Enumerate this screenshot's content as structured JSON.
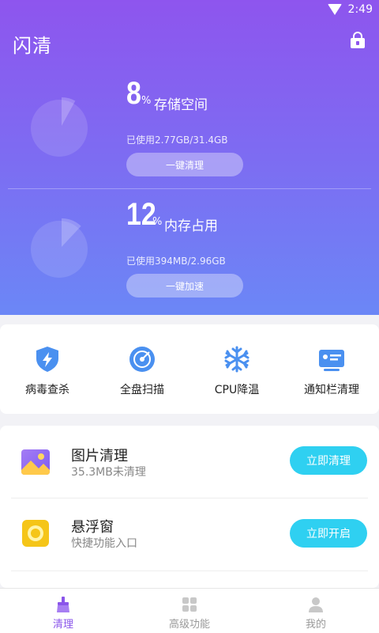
{
  "status_bar": {
    "time": "2:49",
    "wifi_icon": "wifi-icon"
  },
  "header": {
    "title": "闪清",
    "lock_icon": "lock-icon"
  },
  "storage": {
    "percent": "8",
    "percent_sign": "%",
    "label": "存储空间",
    "usage_text": "已使用2.77GB/31.4GB",
    "button_label": "一键清理",
    "used_fraction": 0.08
  },
  "memory": {
    "percent": "12",
    "percent_sign": "%",
    "label": "内存占用",
    "usage_text": "已使用394MB/2.96GB",
    "button_label": "一键加速",
    "used_fraction": 0.12
  },
  "tools": [
    {
      "label": "病毒查杀",
      "icon": "shield-lightning-icon"
    },
    {
      "label": "全盘扫描",
      "icon": "scan-radar-icon"
    },
    {
      "label": "CPU降温",
      "icon": "snowflake-icon"
    },
    {
      "label": "通知栏清理",
      "icon": "notification-card-icon"
    }
  ],
  "features": [
    {
      "title": "图片清理",
      "subtitle": "35.3MB未清理",
      "button": "立即清理",
      "icon": "picture-icon"
    },
    {
      "title": "悬浮窗",
      "subtitle": "快捷功能入口",
      "button": "立即开启",
      "icon": "floating-window-icon"
    }
  ],
  "nav": [
    {
      "label": "清理",
      "icon": "broom-icon",
      "active": true
    },
    {
      "label": "高级功能",
      "icon": "grid-icon",
      "active": false
    },
    {
      "label": "我的",
      "icon": "user-icon",
      "active": false
    }
  ],
  "colors": {
    "hero_top": "#8e55ee",
    "hero_bottom": "#6b87f6",
    "action_button": "#2fd0f1",
    "nav_active": "#8a55ea"
  }
}
